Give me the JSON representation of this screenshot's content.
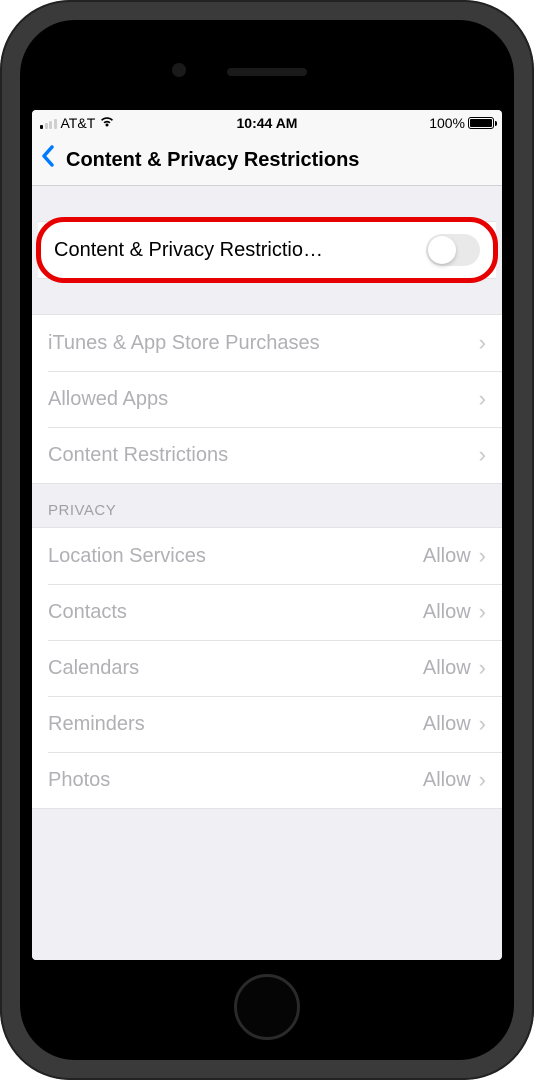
{
  "status": {
    "carrier": "AT&T",
    "time": "10:44 AM",
    "battery_percent": "100%"
  },
  "nav": {
    "title": "Content & Privacy Restrictions"
  },
  "main_toggle": {
    "label": "Content & Privacy Restrictio…",
    "on": false
  },
  "section1": {
    "items": [
      {
        "id": "itunes-app-store",
        "label": "iTunes & App Store Purchases"
      },
      {
        "id": "allowed-apps",
        "label": "Allowed Apps"
      },
      {
        "id": "content-restrictions",
        "label": "Content Restrictions"
      }
    ]
  },
  "privacy": {
    "header": "PRIVACY",
    "items": [
      {
        "id": "location-services",
        "label": "Location Services",
        "value": "Allow"
      },
      {
        "id": "contacts",
        "label": "Contacts",
        "value": "Allow"
      },
      {
        "id": "calendars",
        "label": "Calendars",
        "value": "Allow"
      },
      {
        "id": "reminders",
        "label": "Reminders",
        "value": "Allow"
      },
      {
        "id": "photos",
        "label": "Photos",
        "value": "Allow"
      }
    ]
  }
}
